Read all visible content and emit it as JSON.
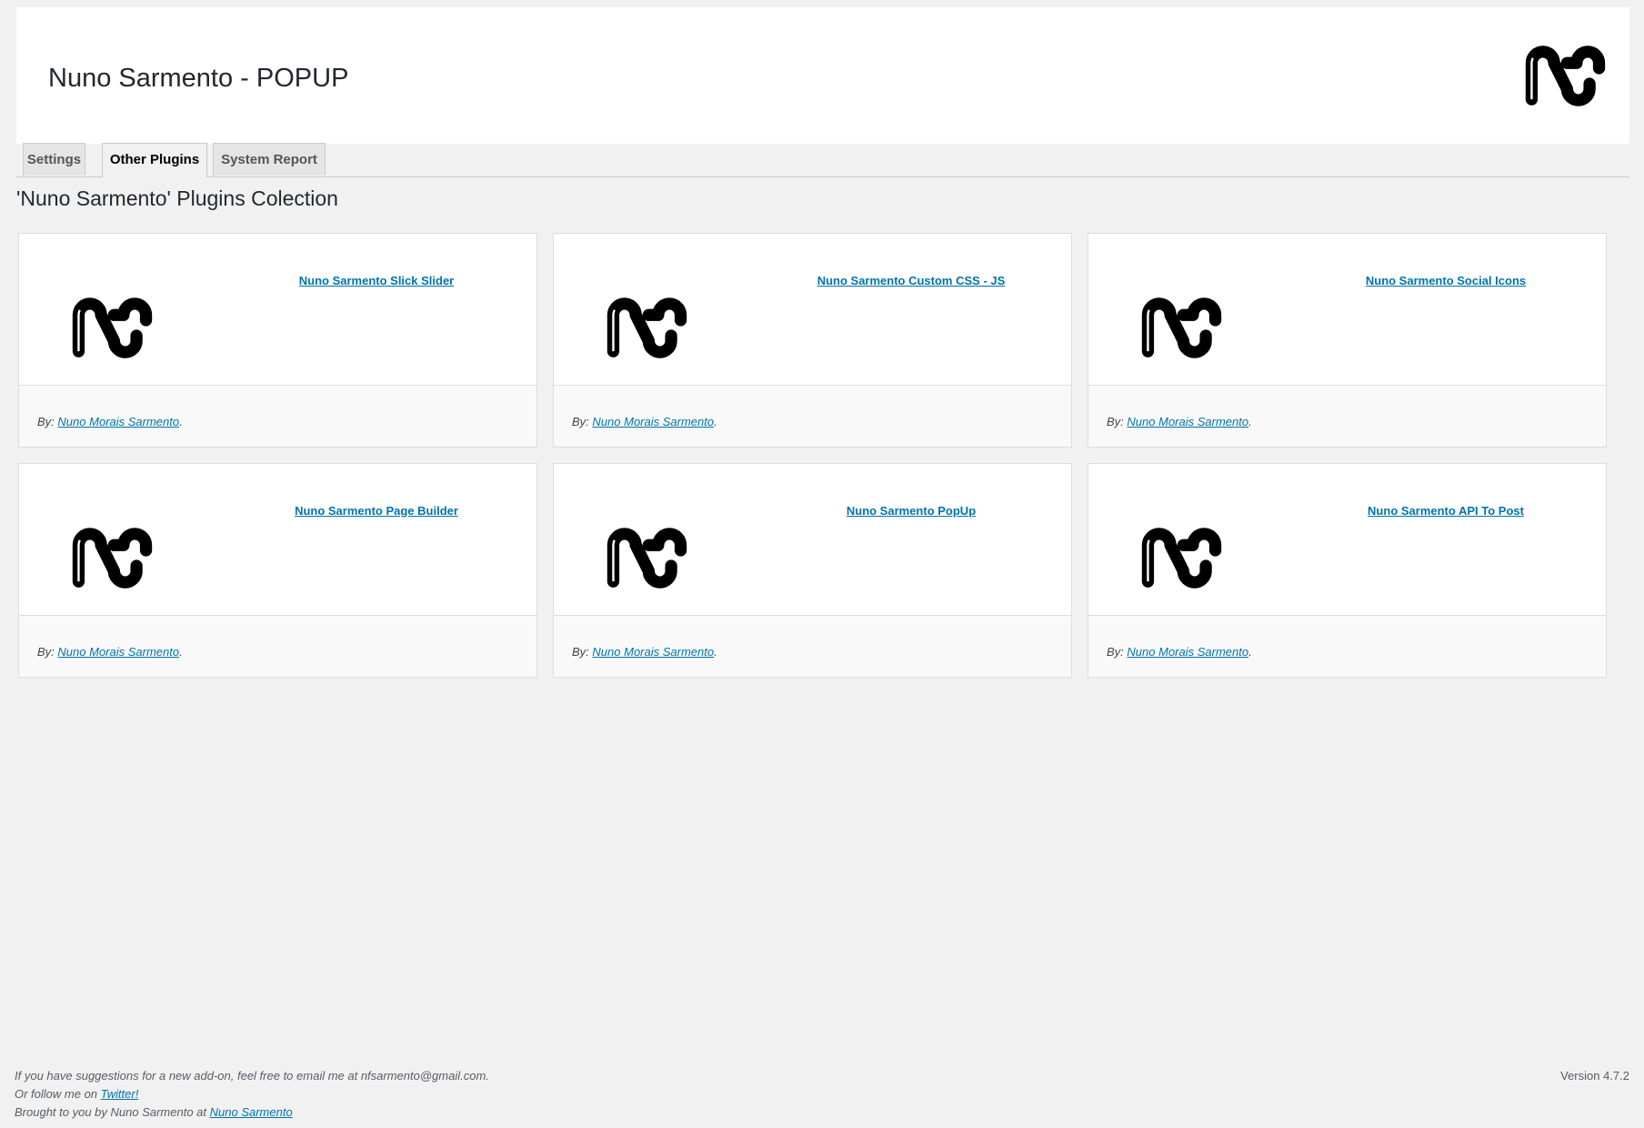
{
  "header": {
    "title": "Nuno Sarmento - POPUP",
    "logo_icon": "ns-logo-icon"
  },
  "tabs": [
    {
      "label": "Settings",
      "active": false
    },
    {
      "label": "Other Plugins",
      "active": true
    },
    {
      "label": "System Report",
      "active": false
    }
  ],
  "page_heading": "'Nuno Sarmento' Plugins Colection",
  "plugins": [
    {
      "title": "Nuno Sarmento Slick Slider",
      "by_label": "By:",
      "author": "Nuno Morais Sarmento",
      "suffix": "."
    },
    {
      "title": "Nuno Sarmento Custom CSS - JS",
      "by_label": "By:",
      "author": "Nuno Morais Sarmento",
      "suffix": "."
    },
    {
      "title": "Nuno Sarmento Social Icons",
      "by_label": "By:",
      "author": "Nuno Morais Sarmento",
      "suffix": "."
    },
    {
      "title": "Nuno Sarmento Page Builder",
      "by_label": "By:",
      "author": "Nuno Morais Sarmento",
      "suffix": "."
    },
    {
      "title": "Nuno Sarmento PopUp",
      "by_label": "By:",
      "author": "Nuno Morais Sarmento",
      "suffix": "."
    },
    {
      "title": "Nuno Sarmento API To Post",
      "by_label": "By:",
      "author": "Nuno Morais Sarmento",
      "suffix": "."
    }
  ],
  "footer": {
    "line1": "If you have suggestions for a new add-on, feel free to email me at nfsarmento@gmail.com.",
    "line2_prefix": "Or follow me on ",
    "line2_link": "Twitter!",
    "line3_prefix": "Brought to you by Nuno Sarmento at ",
    "line3_link": "Nuno Sarmento"
  },
  "version": "Version 4.7.2",
  "colors": {
    "link": "#0073aa",
    "background": "#f1f1f1",
    "text": "#23282d"
  }
}
